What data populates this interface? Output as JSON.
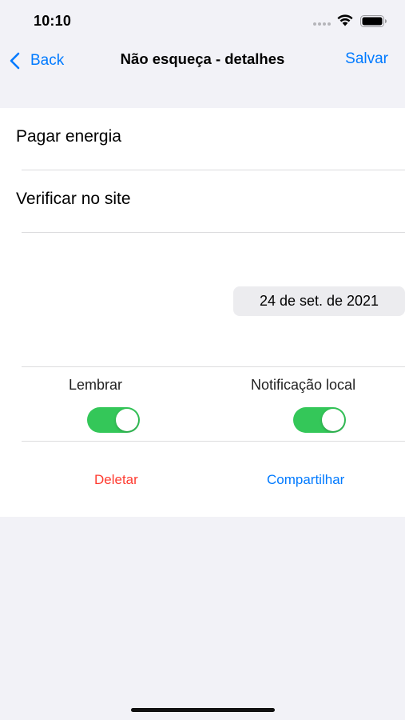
{
  "status_bar": {
    "time": "10:10"
  },
  "nav": {
    "back_label": "Back",
    "title": "Não esqueça - detalhes",
    "save_label": "Salvar"
  },
  "form": {
    "title_value": "Pagar energia",
    "detail_value": "Verificar no site",
    "date_value": "24 de set. de 2021",
    "toggles": [
      {
        "label": "Lembrar",
        "on": true
      },
      {
        "label": "Notificação local",
        "on": true
      }
    ],
    "delete_label": "Deletar",
    "share_label": "Compartilhar"
  },
  "colors": {
    "accent": "#007aff",
    "destructive": "#ff3b30",
    "toggle_on": "#34c759",
    "background": "#f2f2f7"
  }
}
